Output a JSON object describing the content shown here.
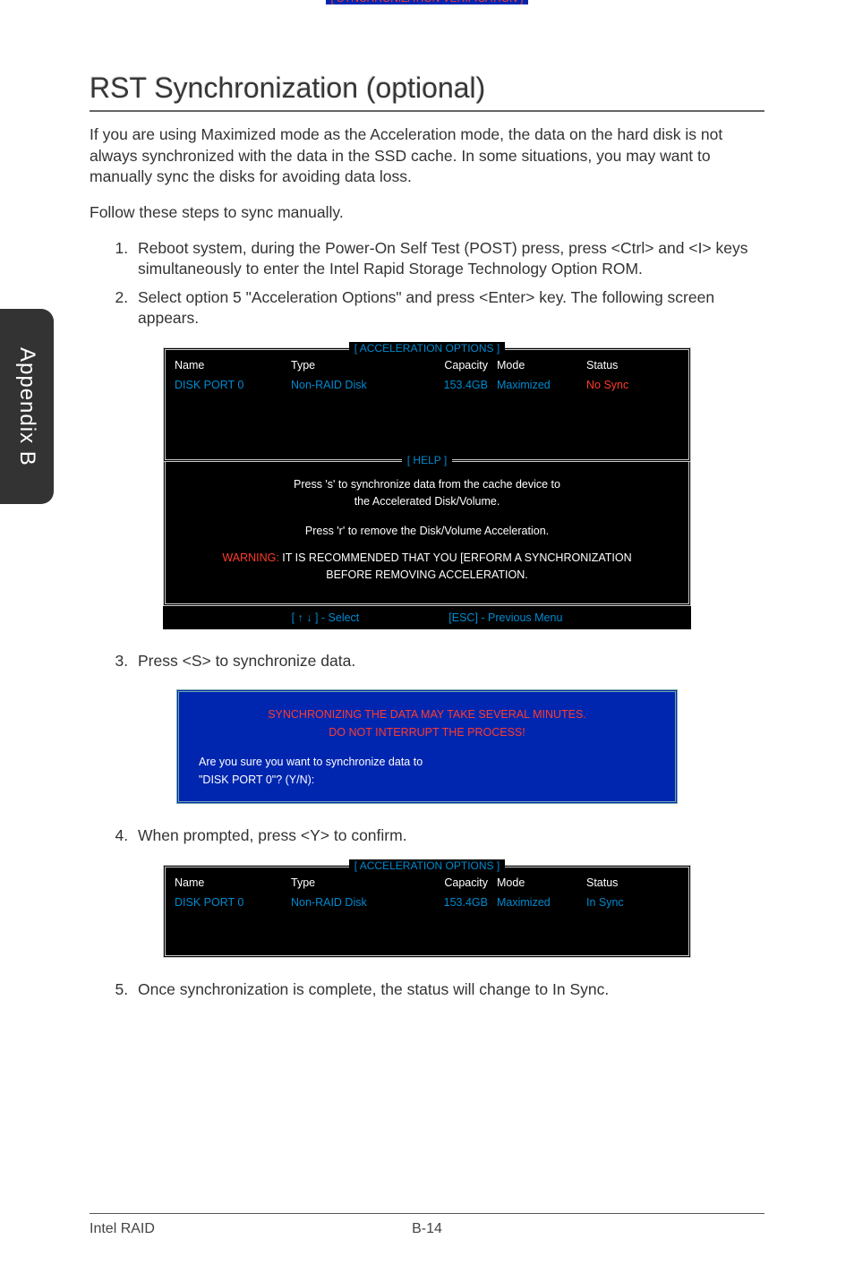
{
  "sideTab": "Appendix B",
  "heading": "RST Synchronization (optional)",
  "intro": "If you are using Maximized mode as the Acceleration mode, the data on the hard disk is not always synchronized with the data in the SSD cache. In some situations, you may want to manually sync the disks for avoiding data loss.",
  "followThese": "Follow these steps to sync manually.",
  "step1": "Reboot system, during the Power-On Self Test (POST) press, press <Ctrl> and <I> keys simultaneously to enter the Intel Rapid Storage Technology Option ROM.",
  "step2": "Select option 5 \"Acceleration Options\" and press <Enter> key. The following screen appears.",
  "step3": "Press <S> to synchronize data.",
  "step4": "When prompted, press <Y> to confirm.",
  "step5": "Once synchronization is complete, the status will change to In Sync.",
  "bios1": {
    "title": "[ ACCELERATION OPTIONS ]",
    "headers": {
      "name": "Name",
      "type": "Type",
      "capacity": "Capacity",
      "mode": "Mode",
      "status": "Status"
    },
    "row": {
      "name": "DISK PORT 0",
      "type": "Non-RAID Disk",
      "capacity": "153.4GB",
      "mode": "Maximized",
      "status": "No Sync"
    },
    "helpTitle": "[  HELP  ]",
    "helpLine1": "Press 's' to synchronize data from the cache device to",
    "helpLine2": "the Accelerated Disk/Volume.",
    "helpLine3": "Press 'r' to remove the Disk/Volume Acceleration.",
    "warnLabel": "WARNING:",
    "warnText1": " IT IS RECOMMENDED THAT YOU [ERFORM A SYNCHRONIZATION",
    "warnText2": "BEFORE REMOVING ACCELERATION.",
    "keySelect": "[ ↑ ↓ ] - Select",
    "keyEsc": "[ESC] - Previous Menu"
  },
  "bios2": {
    "title": "[ SYNCHRONIZATION VERIFICATION ]",
    "line1": "SYNCHRONIZING THE DATA MAY TAKE SEVERAL MINUTES.",
    "line2": "DO NOT INTERRUPT THE PROCESS!",
    "prompt1": "Are you sure you want to synchronize data to",
    "prompt2": "\"DISK PORT 0\"? (Y/N):"
  },
  "bios3": {
    "title": "[ ACCELERATION OPTIONS ]",
    "headers": {
      "name": "Name",
      "type": "Type",
      "capacity": "Capacity",
      "mode": "Mode",
      "status": "Status"
    },
    "row": {
      "name": "DISK PORT 0",
      "type": "Non-RAID Disk",
      "capacity": "153.4GB",
      "mode": "Maximized",
      "status": "In Sync"
    }
  },
  "footer": {
    "left": "Intel RAID",
    "page": "B-14"
  }
}
